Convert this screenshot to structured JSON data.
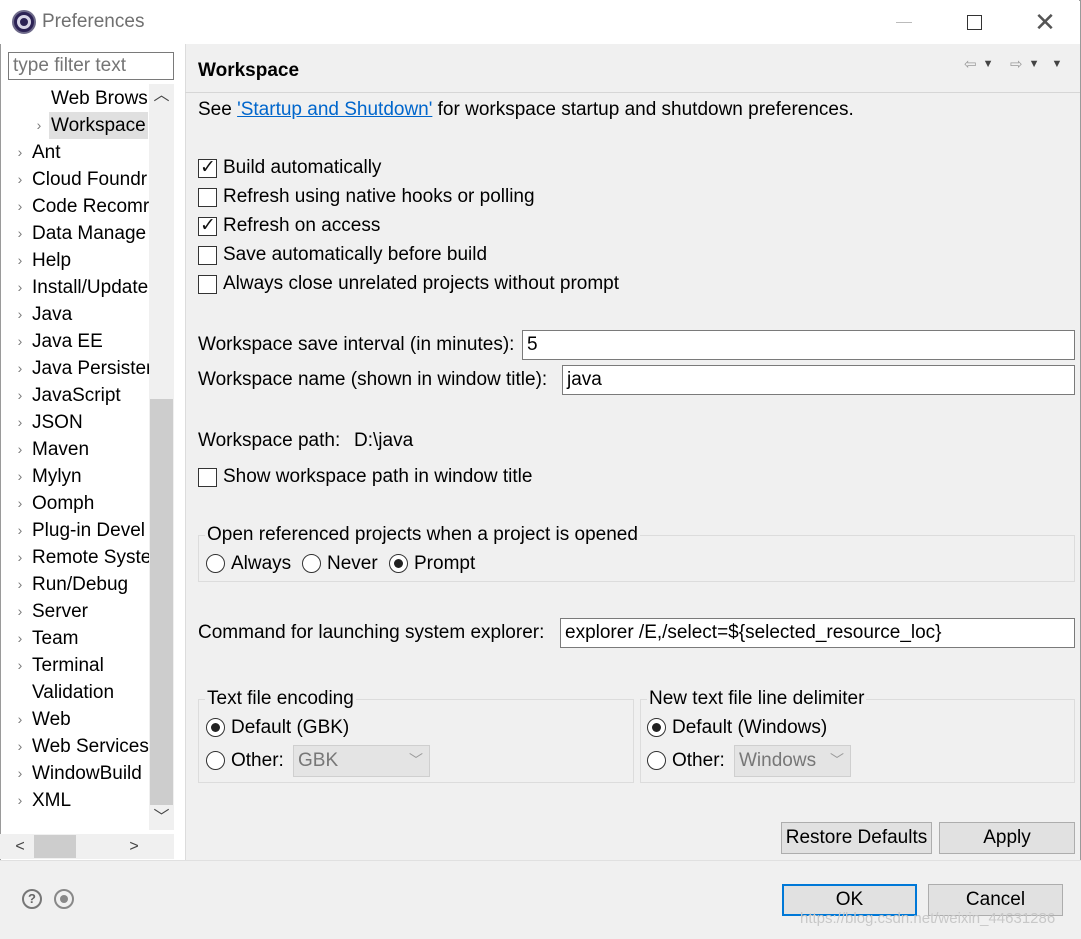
{
  "window": {
    "title": "Preferences"
  },
  "sidebar": {
    "filter_placeholder": "type filter text",
    "items": [
      {
        "label": "Web Brows",
        "expandable": false,
        "indent": 1
      },
      {
        "label": "Workspace",
        "expandable": true,
        "indent": 1,
        "selected": true
      },
      {
        "label": "Ant",
        "expandable": true
      },
      {
        "label": "Cloud Foundr",
        "expandable": true
      },
      {
        "label": "Code Recomr",
        "expandable": true
      },
      {
        "label": "Data Manage",
        "expandable": true
      },
      {
        "label": "Help",
        "expandable": true
      },
      {
        "label": "Install/Update",
        "expandable": true
      },
      {
        "label": "Java",
        "expandable": true
      },
      {
        "label": "Java EE",
        "expandable": true
      },
      {
        "label": "Java Persisten",
        "expandable": true
      },
      {
        "label": "JavaScript",
        "expandable": true
      },
      {
        "label": "JSON",
        "expandable": true
      },
      {
        "label": "Maven",
        "expandable": true
      },
      {
        "label": "Mylyn",
        "expandable": true
      },
      {
        "label": "Oomph",
        "expandable": true
      },
      {
        "label": "Plug-in Devel",
        "expandable": true
      },
      {
        "label": "Remote Syste",
        "expandable": true
      },
      {
        "label": "Run/Debug",
        "expandable": true
      },
      {
        "label": "Server",
        "expandable": true
      },
      {
        "label": "Team",
        "expandable": true
      },
      {
        "label": "Terminal",
        "expandable": true
      },
      {
        "label": "Validation",
        "expandable": false
      },
      {
        "label": "Web",
        "expandable": true
      },
      {
        "label": "Web Services",
        "expandable": true
      },
      {
        "label": "WindowBuild",
        "expandable": true
      },
      {
        "label": "XML",
        "expandable": true
      }
    ]
  },
  "page": {
    "title": "Workspace",
    "intro_prefix": "See ",
    "intro_link": "'Startup and Shutdown'",
    "intro_suffix": " for workspace startup and shutdown preferences.",
    "checkboxes": [
      {
        "label": "Build automatically",
        "checked": true
      },
      {
        "label": "Refresh using native hooks or polling",
        "checked": false
      },
      {
        "label": "Refresh on access",
        "checked": true
      },
      {
        "label": "Save automatically before build",
        "checked": false
      },
      {
        "label": "Always close unrelated projects without prompt",
        "checked": false
      }
    ],
    "save_interval_label": "Workspace save interval (in minutes):",
    "save_interval_value": "5",
    "workspace_name_label": "Workspace name (shown in window title):",
    "workspace_name_value": "java",
    "workspace_path_label": "Workspace path:",
    "workspace_path_value": "D:\\java",
    "show_path_label": "Show workspace path in window title",
    "show_path_checked": false,
    "open_ref_group_label": "Open referenced projects when a project is opened",
    "open_ref_options": [
      {
        "label": "Always",
        "selected": false
      },
      {
        "label": "Never",
        "selected": false
      },
      {
        "label": "Prompt",
        "selected": true
      }
    ],
    "explorer_label": "Command for launching system explorer:",
    "explorer_value": "explorer /E,/select=${selected_resource_loc}",
    "encoding_group_label": "Text file encoding",
    "encoding_default_label": "Default (GBK)",
    "encoding_other_label": "Other:",
    "encoding_other_value": "GBK",
    "delimiter_group_label": "New text file line delimiter",
    "delimiter_default_label": "Default (Windows)",
    "delimiter_other_label": "Other:",
    "delimiter_other_value": "Windows",
    "restore_defaults_label": "Restore Defaults",
    "apply_label": "Apply"
  },
  "footer": {
    "ok_label": "OK",
    "cancel_label": "Cancel",
    "watermark": "https://blog.csdn.net/weixin_44631286"
  }
}
